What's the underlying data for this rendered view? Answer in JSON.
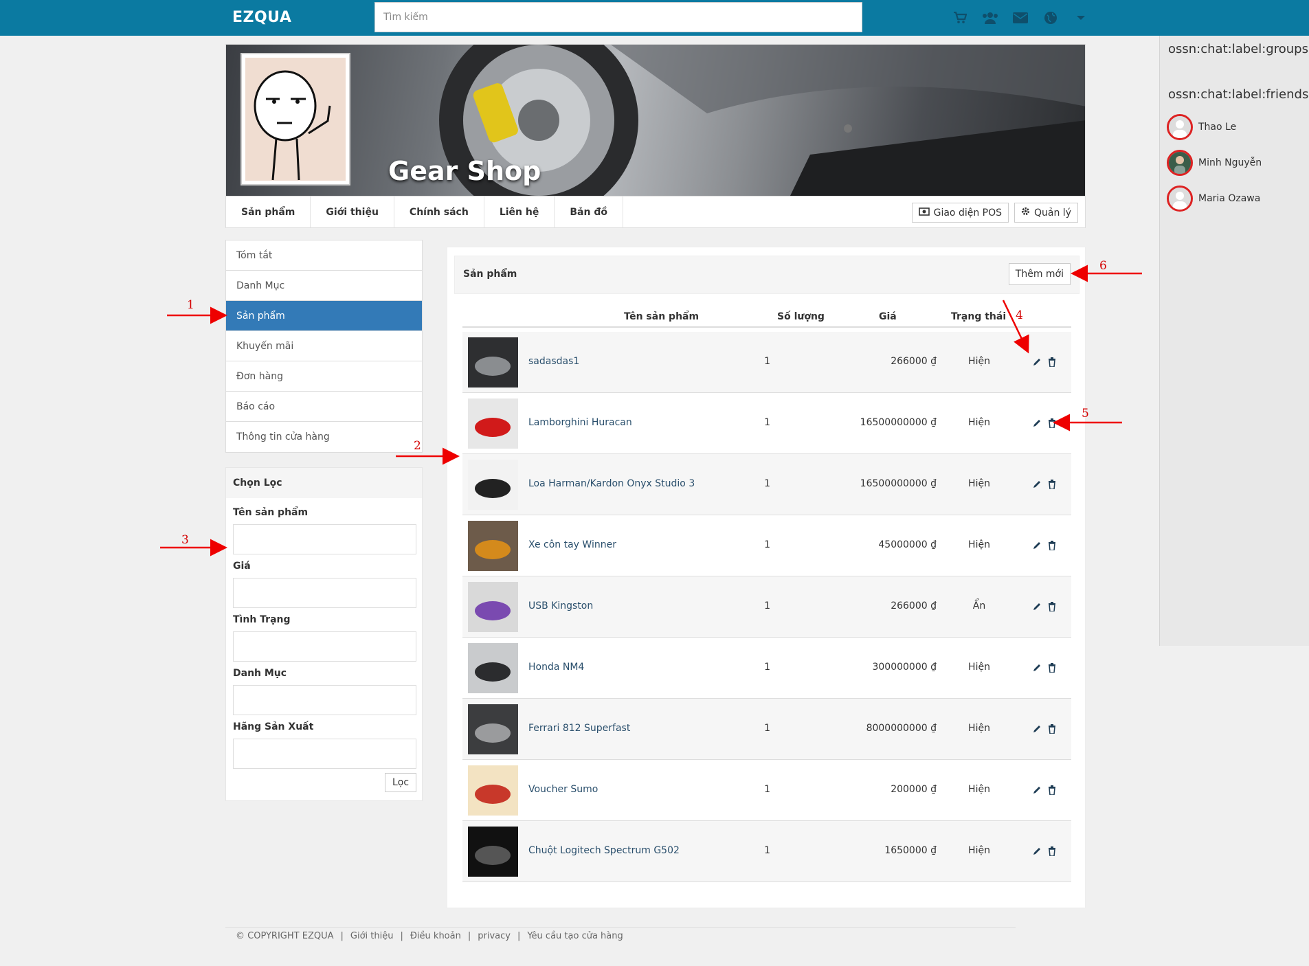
{
  "topbar": {
    "brand": "EZQUA",
    "search_placeholder": "Tìm kiếm",
    "icons": [
      "cart-icon",
      "users-icon",
      "envelope-icon",
      "globe-icon",
      "caret-down-icon"
    ],
    "color": "#0b7aa1"
  },
  "cover": {
    "title": "Gear Shop"
  },
  "profile_nav": {
    "items": [
      "Sản phẩm",
      "Giới thiệu",
      "Chính sách",
      "Liên hệ",
      "Bản đồ"
    ],
    "pos_button": "Giao diện POS",
    "manage_button": "Quản lý"
  },
  "side_menu": {
    "items": [
      "Tóm tắt",
      "Danh Mục",
      "Sản phẩm",
      "Khuyến mãi",
      "Đơn hàng",
      "Báo cáo",
      "Thông tin cửa hàng"
    ],
    "active_index": 2,
    "active_color": "#337ab7"
  },
  "filter": {
    "title": "Chọn Lọc",
    "fields": [
      "Tên sản phẩm",
      "Giá",
      "Tình Trạng",
      "Danh Mục",
      "Hãng Sản Xuất"
    ],
    "submit": "Lọc"
  },
  "products": {
    "title": "Sản phẩm",
    "add_button": "Thêm mới",
    "columns": [
      "Tên sản phẩm",
      "Số lượng",
      "Giá",
      "Trạng thái"
    ],
    "rows": [
      {
        "name": "sadasdas1",
        "qty": "1",
        "price": "266000 ₫",
        "status": "Hiện"
      },
      {
        "name": "Lamborghini Huracan",
        "qty": "1",
        "price": "16500000000 ₫",
        "status": "Hiện"
      },
      {
        "name": "Loa Harman/Kardon Onyx Studio 3",
        "qty": "1",
        "price": "16500000000 ₫",
        "status": "Hiện"
      },
      {
        "name": "Xe côn tay Winner",
        "qty": "1",
        "price": "45000000 ₫",
        "status": "Hiện"
      },
      {
        "name": "USB Kingston",
        "qty": "1",
        "price": "266000 ₫",
        "status": "Ẩn"
      },
      {
        "name": "Honda NM4",
        "qty": "1",
        "price": "300000000 ₫",
        "status": "Hiện"
      },
      {
        "name": "Ferrari 812 Superfast",
        "qty": "1",
        "price": "8000000000 ₫",
        "status": "Hiện"
      },
      {
        "name": "Voucher Sumo",
        "qty": "1",
        "price": "200000 ₫",
        "status": "Hiện"
      },
      {
        "name": "Chuột Logitech Spectrum G502",
        "qty": "1",
        "price": "1650000 ₫",
        "status": "Hiện"
      }
    ]
  },
  "chat": {
    "groups_label": "ossn:chat:label:groups",
    "friends_label": "ossn:chat:label:friends",
    "friends": [
      "Thao Le",
      "Minh Nguyễn",
      "Maria Ozawa"
    ]
  },
  "footer": {
    "copyright": "© COPYRIGHT EZQUA",
    "links": [
      "Giới thiệu",
      "Điều khoản",
      "privacy",
      "Yêu cầu tạo cửa hàng"
    ]
  },
  "annotations": [
    "1",
    "2",
    "3",
    "4",
    "5",
    "6"
  ],
  "annotation_color": "#d40000"
}
